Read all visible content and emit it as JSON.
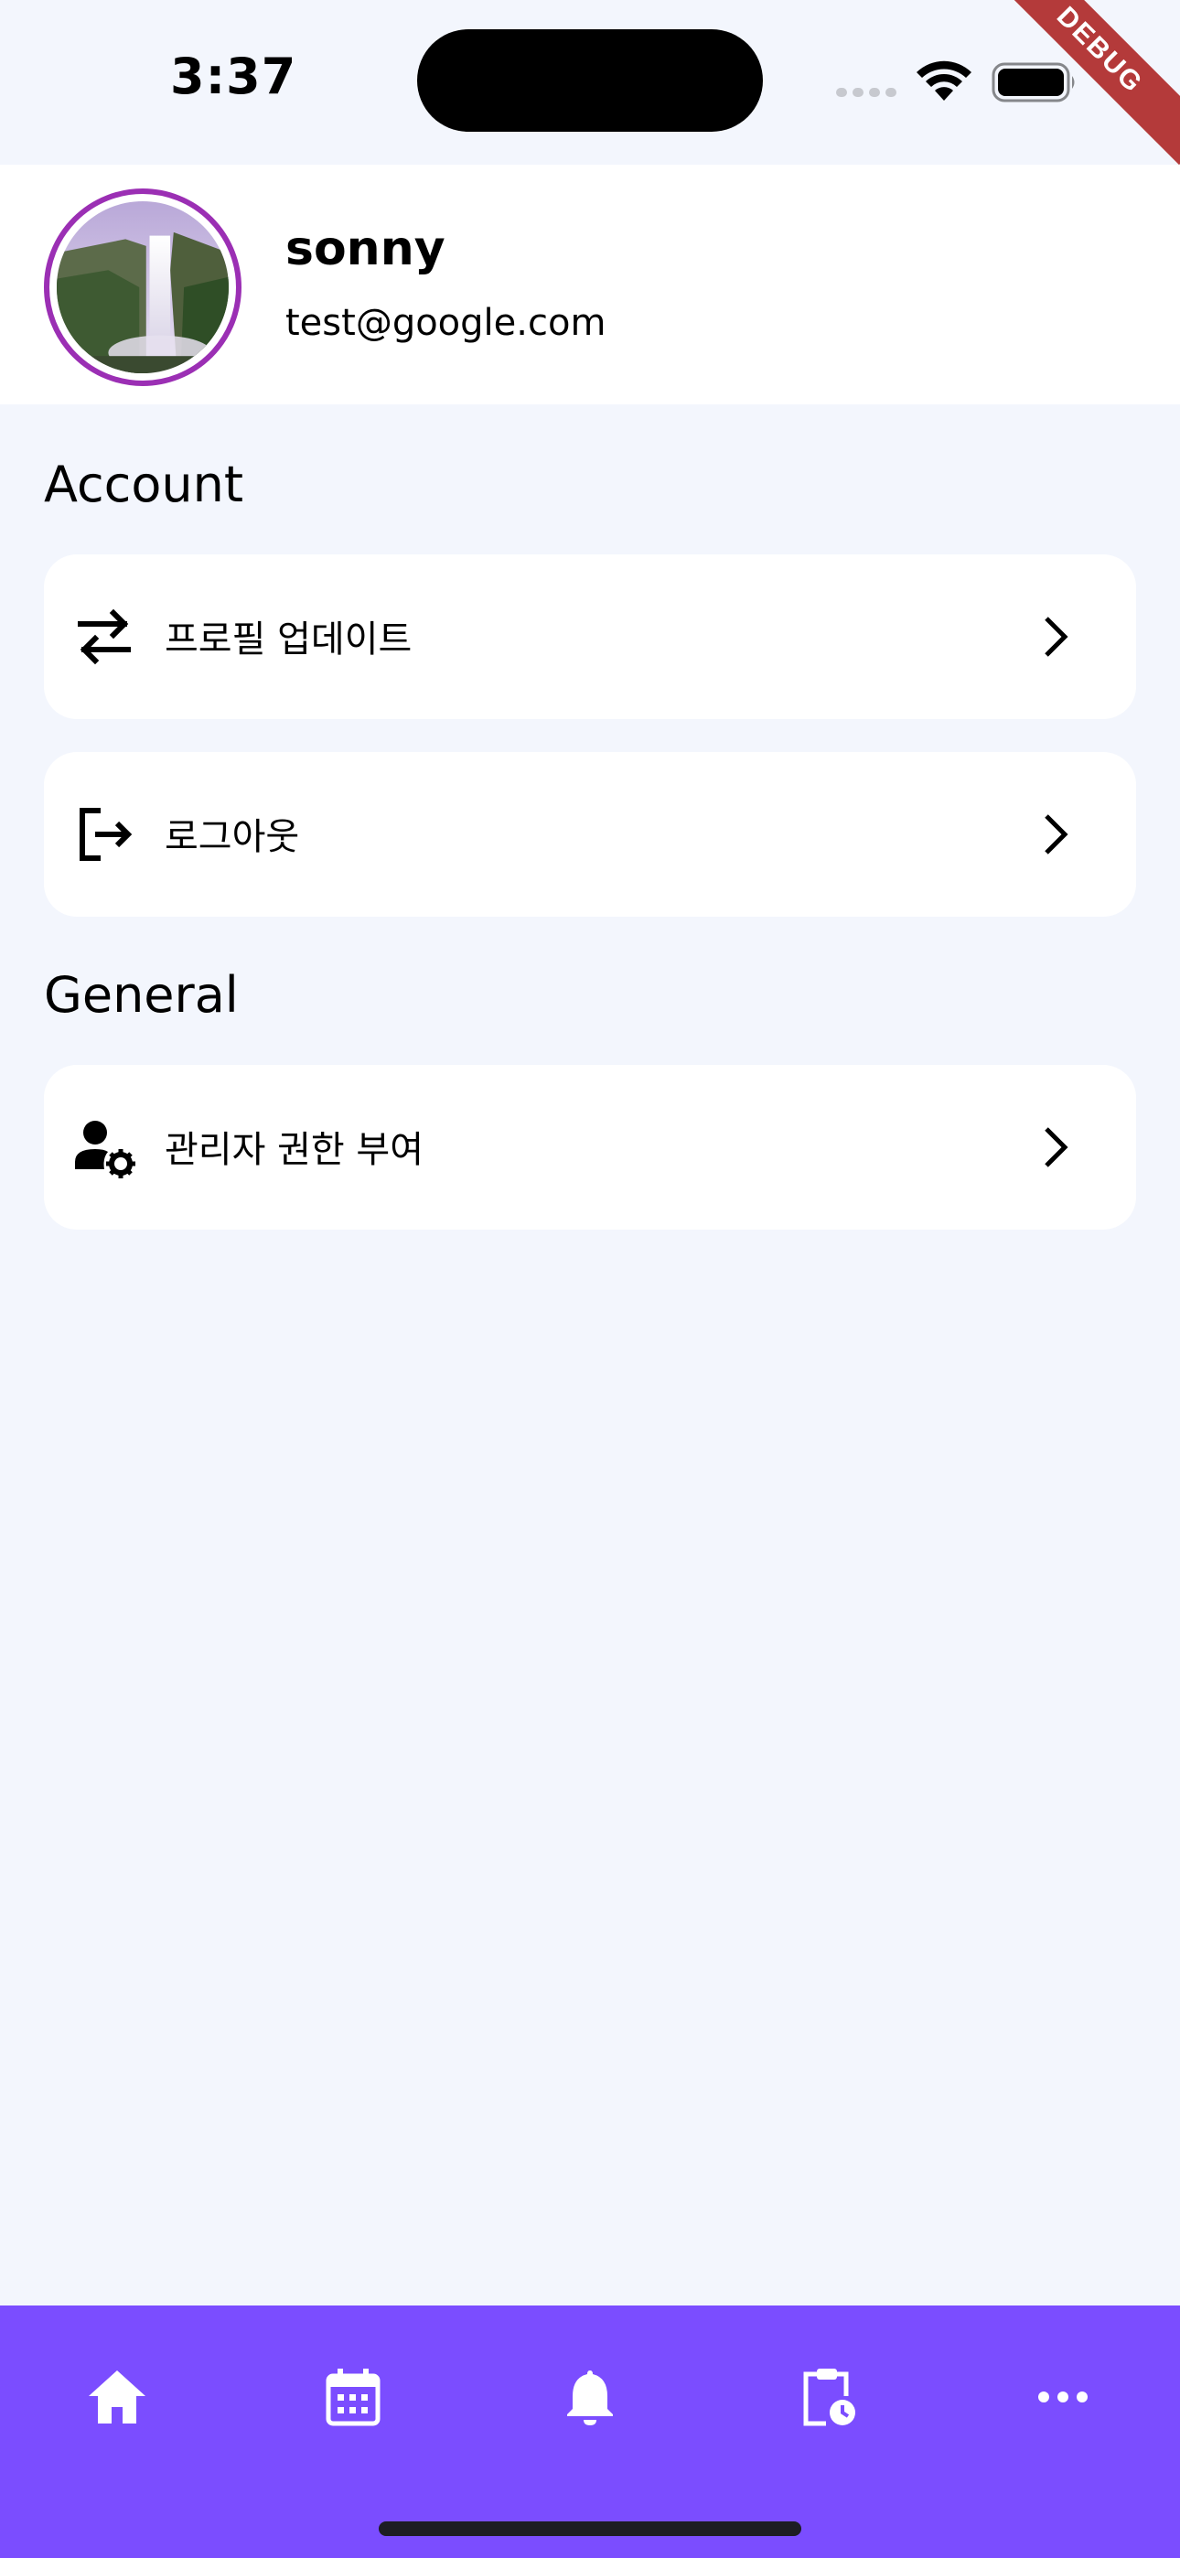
{
  "status_bar": {
    "time": "3:37",
    "icons": [
      "cellular-dots-icon",
      "wifi-icon",
      "battery-icon"
    ]
  },
  "debug_banner": "DEBUG",
  "profile": {
    "name": "sonny",
    "email": "test@google.com",
    "avatar_ring_color": "#9b2fb4"
  },
  "sections": {
    "account": {
      "title": "Account",
      "items": [
        {
          "label": "프로필 업데이트",
          "icon": "swap-arrows-icon"
        },
        {
          "label": "로그아웃",
          "icon": "logout-icon"
        }
      ]
    },
    "general": {
      "title": "General",
      "items": [
        {
          "label": "관리자 권한 부여",
          "icon": "manage-accounts-icon"
        }
      ]
    }
  },
  "bottom_nav": {
    "background": "#7b4dff",
    "items": [
      {
        "icon": "home-icon"
      },
      {
        "icon": "calendar-icon"
      },
      {
        "icon": "bell-icon"
      },
      {
        "icon": "clipboard-clock-icon"
      },
      {
        "icon": "more-horizontal-icon"
      }
    ]
  }
}
